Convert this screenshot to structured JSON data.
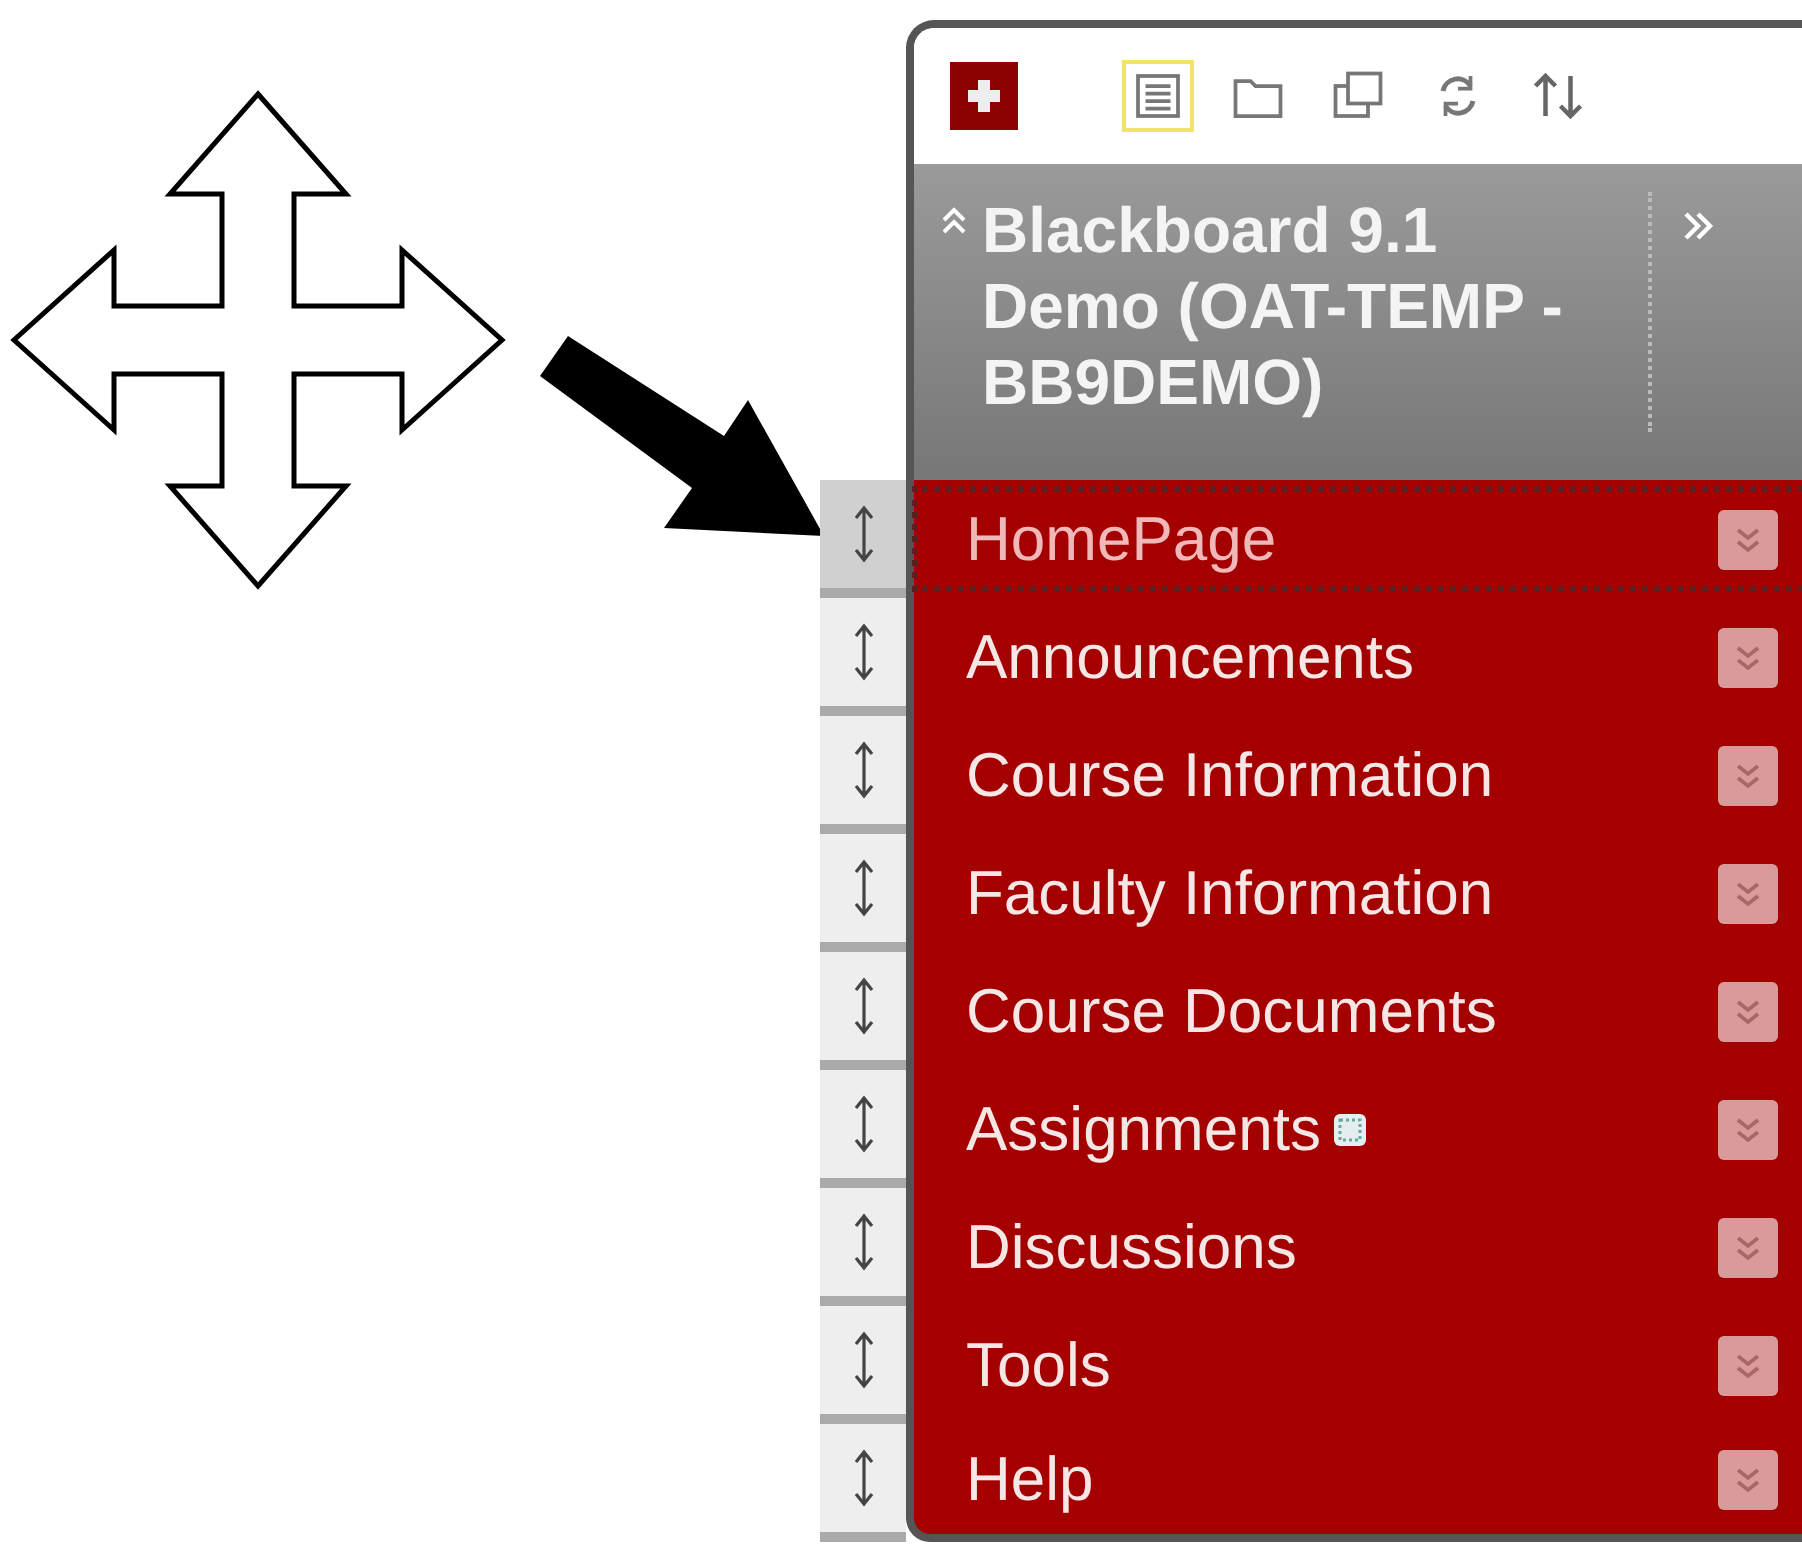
{
  "toolbar": [
    {
      "selected": true
    },
    {
      "selected": false
    },
    {
      "selected": false
    },
    {
      "selected": false
    },
    {
      "selected": false
    }
  ],
  "course_title": "Blackboard 9.1 Demo (OAT-TEMP -BB9DEMO)",
  "menu_items": [
    {
      "label": "HomePage",
      "selected": true,
      "new_content": false
    },
    {
      "label": "Announcements",
      "selected": false,
      "new_content": false
    },
    {
      "label": "Course Information",
      "selected": false,
      "new_content": false
    },
    {
      "label": "Faculty Information",
      "selected": false,
      "new_content": false
    },
    {
      "label": "Course Documents",
      "selected": false,
      "new_content": false
    },
    {
      "label": "Assignments",
      "selected": false,
      "new_content": true
    },
    {
      "label": "Discussions",
      "selected": false,
      "new_content": false
    },
    {
      "label": "Tools",
      "selected": false,
      "new_content": false
    },
    {
      "label": "Help",
      "selected": false,
      "new_content": false
    }
  ]
}
